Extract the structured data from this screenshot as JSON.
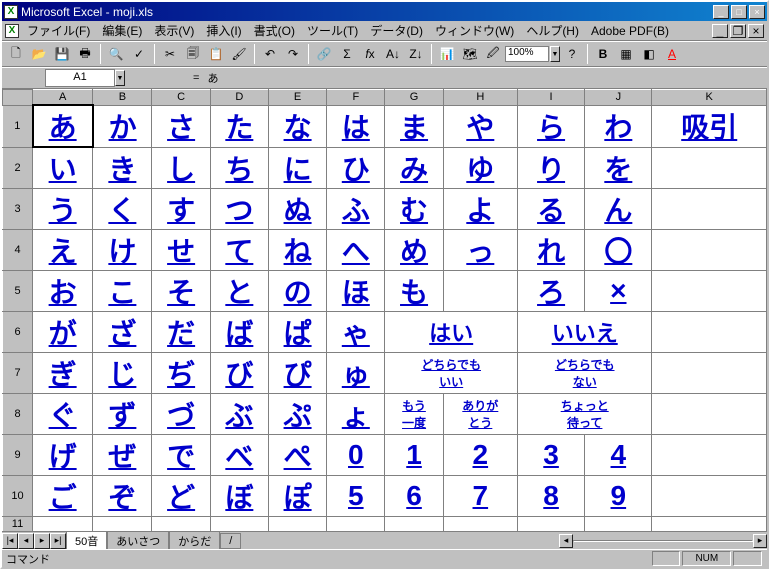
{
  "title": "Microsoft Excel - moji.xls",
  "menu": [
    "ファイル(F)",
    "編集(E)",
    "表示(V)",
    "挿入(I)",
    "書式(O)",
    "ツール(T)",
    "データ(D)",
    "ウィンドウ(W)",
    "ヘルプ(H)",
    "Adobe PDF(B)"
  ],
  "namebox": "A1",
  "fxvalue": "あ",
  "zoom": "100%",
  "cols": [
    "A",
    "B",
    "C",
    "D",
    "E",
    "F",
    "G",
    "H",
    "I",
    "J",
    "K"
  ],
  "rows": [
    "1",
    "2",
    "3",
    "4",
    "5",
    "6",
    "7",
    "8",
    "9",
    "10",
    "11"
  ],
  "chart_data": {
    "type": "table",
    "title": "50音 hiragana input grid",
    "cells": [
      [
        {
          "t": "あ",
          "cs": 1
        },
        {
          "t": "か"
        },
        {
          "t": "さ"
        },
        {
          "t": "た"
        },
        {
          "t": "な"
        },
        {
          "t": "は"
        },
        {
          "t": "ま"
        },
        {
          "t": "や"
        },
        {
          "t": "ら"
        },
        {
          "t": "わ"
        },
        {
          "t": "吸引"
        }
      ],
      [
        {
          "t": "い"
        },
        {
          "t": "き"
        },
        {
          "t": "し"
        },
        {
          "t": "ち"
        },
        {
          "t": "に"
        },
        {
          "t": "ひ"
        },
        {
          "t": "み"
        },
        {
          "t": "ゆ"
        },
        {
          "t": "り"
        },
        {
          "t": "を"
        },
        {
          "t": ""
        }
      ],
      [
        {
          "t": "う"
        },
        {
          "t": "く"
        },
        {
          "t": "す"
        },
        {
          "t": "つ"
        },
        {
          "t": "ぬ"
        },
        {
          "t": "ふ"
        },
        {
          "t": "む"
        },
        {
          "t": "よ"
        },
        {
          "t": "る"
        },
        {
          "t": "ん"
        },
        {
          "t": ""
        }
      ],
      [
        {
          "t": "え"
        },
        {
          "t": "け"
        },
        {
          "t": "せ"
        },
        {
          "t": "て"
        },
        {
          "t": "ね"
        },
        {
          "t": "へ"
        },
        {
          "t": "め"
        },
        {
          "t": "っ"
        },
        {
          "t": "れ"
        },
        {
          "t": "〇"
        },
        {
          "t": ""
        }
      ],
      [
        {
          "t": "お"
        },
        {
          "t": "こ"
        },
        {
          "t": "そ"
        },
        {
          "t": "と"
        },
        {
          "t": "の"
        },
        {
          "t": "ほ"
        },
        {
          "t": "も"
        },
        {
          "t": ""
        },
        {
          "t": "ろ"
        },
        {
          "t": "×"
        },
        {
          "t": ""
        }
      ],
      [
        {
          "t": "が"
        },
        {
          "t": "ざ"
        },
        {
          "t": "だ"
        },
        {
          "t": "ば"
        },
        {
          "t": "ぱ"
        },
        {
          "t": "ゃ"
        },
        {
          "t": "はい",
          "cs": 2,
          "md": 1
        },
        {
          "t": "いいえ",
          "cs": 2,
          "md": 1
        },
        {
          "t": ""
        }
      ],
      [
        {
          "t": "ぎ"
        },
        {
          "t": "じ"
        },
        {
          "t": "ぢ"
        },
        {
          "t": "び"
        },
        {
          "t": "ぴ"
        },
        {
          "t": "ゅ"
        },
        {
          "t": "どちらでも\nいい",
          "cs": 2,
          "sm": 1
        },
        {
          "t": "どちらでも\nない",
          "cs": 2,
          "sm": 1
        },
        {
          "t": ""
        }
      ],
      [
        {
          "t": "ぐ"
        },
        {
          "t": "ず"
        },
        {
          "t": "づ"
        },
        {
          "t": "ぶ"
        },
        {
          "t": "ぷ"
        },
        {
          "t": "ょ"
        },
        {
          "t": "もう\n一度",
          "sm": 1
        },
        {
          "t": "ありが\nとう",
          "sm": 1
        },
        {
          "t": "ちょっと\n待って",
          "cs": 2,
          "sm": 1
        },
        {
          "t": ""
        }
      ],
      [
        {
          "t": "げ"
        },
        {
          "t": "ぜ"
        },
        {
          "t": "で"
        },
        {
          "t": "べ"
        },
        {
          "t": "ぺ"
        },
        {
          "t": "0"
        },
        {
          "t": "1"
        },
        {
          "t": "2"
        },
        {
          "t": "3"
        },
        {
          "t": "4"
        },
        {
          "t": ""
        }
      ],
      [
        {
          "t": "ご"
        },
        {
          "t": "ぞ"
        },
        {
          "t": "ど"
        },
        {
          "t": "ぼ"
        },
        {
          "t": "ぽ"
        },
        {
          "t": "5"
        },
        {
          "t": "6"
        },
        {
          "t": "7"
        },
        {
          "t": "8"
        },
        {
          "t": "9"
        },
        {
          "t": ""
        }
      ]
    ]
  },
  "tabs": {
    "active": "50音",
    "others": [
      "あいさつ",
      "からだ"
    ]
  },
  "status": "コマンド",
  "numlock": "NUM"
}
